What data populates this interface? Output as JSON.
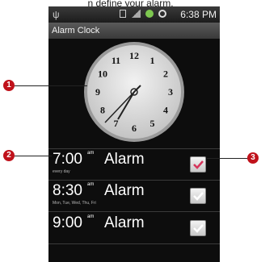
{
  "caption": "n define your alarm.",
  "status_bar": {
    "time": "6:38 PM",
    "usb_icon": "usb-icon"
  },
  "title_bar": {
    "title": "Alarm Clock"
  },
  "clock": {
    "numerals": [
      "12",
      "1",
      "2",
      "3",
      "4",
      "5",
      "6",
      "7",
      "8",
      "9",
      "10",
      "11"
    ]
  },
  "alarms": [
    {
      "time": "7:00",
      "ampm": "am",
      "label": "Alarm",
      "days": "every day",
      "checked": true,
      "check_color": "#d6355c"
    },
    {
      "time": "8:30",
      "ampm": "am",
      "label": "Alarm",
      "days": "Mon, Tue, Wed, Thu, Fri",
      "checked": true,
      "check_color": "#ffffff"
    },
    {
      "time": "9:00",
      "ampm": "am",
      "label": "Alarm",
      "days": "",
      "checked": true,
      "check_color": "#ffffff"
    }
  ],
  "callouts": [
    "1",
    "2",
    "3"
  ],
  "colors": {
    "callout": "#c0121b",
    "background": "#0d0d0d"
  }
}
